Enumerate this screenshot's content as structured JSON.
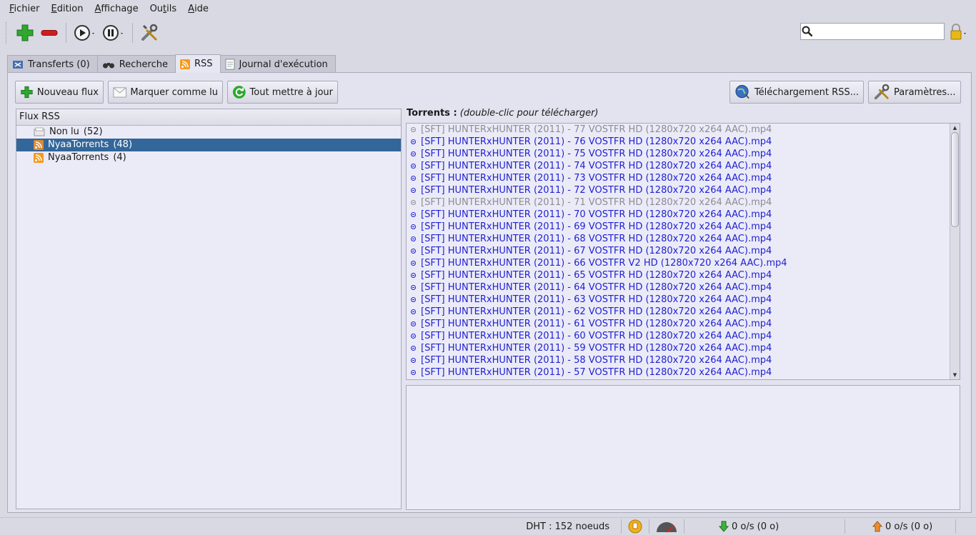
{
  "menu": [
    "Fichier",
    "Edition",
    "Affichage",
    "Outils",
    "Aide"
  ],
  "menu_mnemonics": [
    "F",
    "E",
    "A",
    "t",
    "A"
  ],
  "search": {
    "value": ""
  },
  "tabs": [
    {
      "label": "Transferts (0)",
      "icon": "transfer-icon"
    },
    {
      "label": "Recherche",
      "icon": "binoculars-icon"
    },
    {
      "label": "RSS",
      "icon": "rss-icon"
    },
    {
      "label": "Journal d'exécution",
      "icon": "log-icon"
    }
  ],
  "rss_buttons": {
    "new_feed": "Nouveau flux",
    "mark_read": "Marquer comme lu",
    "update_all": "Tout mettre à jour",
    "rss_download": "Téléchargement RSS...",
    "settings": "Paramètres..."
  },
  "feeds": {
    "header": "Flux RSS",
    "items": [
      {
        "name": "Non lu",
        "count": "(52)",
        "icon": "unread-icon"
      },
      {
        "name": "NyaaTorrents",
        "count": "(48)",
        "icon": "rss-feed-icon",
        "selected": true
      },
      {
        "name": "NyaaTorrents",
        "count": "(4)",
        "icon": "rss-feed-icon"
      }
    ]
  },
  "torrents": {
    "label": "Torrents :",
    "hint": "(double-clic pour télécharger)",
    "items": [
      {
        "title": "[SFT] HUNTERxHUNTER (2011) - 77 VOSTFR HD (1280x720 x264 AAC).mp4",
        "read": true
      },
      {
        "title": "[SFT] HUNTERxHUNTER (2011) - 76 VOSTFR HD (1280x720 x264 AAC).mp4",
        "read": false
      },
      {
        "title": "[SFT] HUNTERxHUNTER (2011) - 75 VOSTFR HD (1280x720 x264 AAC).mp4",
        "read": false
      },
      {
        "title": "[SFT] HUNTERxHUNTER (2011) - 74 VOSTFR HD (1280x720 x264 AAC).mp4",
        "read": false
      },
      {
        "title": "[SFT] HUNTERxHUNTER (2011) - 73 VOSTFR HD (1280x720 x264 AAC).mp4",
        "read": false
      },
      {
        "title": "[SFT] HUNTERxHUNTER (2011) - 72 VOSTFR HD (1280x720 x264 AAC).mp4",
        "read": false
      },
      {
        "title": "[SFT] HUNTERxHUNTER (2011) - 71 VOSTFR HD (1280x720 x264 AAC).mp4",
        "read": true
      },
      {
        "title": "[SFT] HUNTERxHUNTER (2011) - 70 VOSTFR HD (1280x720 x264 AAC).mp4",
        "read": false
      },
      {
        "title": "[SFT] HUNTERxHUNTER (2011) - 69 VOSTFR HD (1280x720 x264 AAC).mp4",
        "read": false
      },
      {
        "title": "[SFT] HUNTERxHUNTER (2011) - 68 VOSTFR HD (1280x720 x264 AAC).mp4",
        "read": false
      },
      {
        "title": "[SFT] HUNTERxHUNTER (2011) - 67 VOSTFR HD (1280x720 x264 AAC).mp4",
        "read": false
      },
      {
        "title": "[SFT] HUNTERxHUNTER (2011) - 66 VOSTFR V2 HD (1280x720 x264 AAC).mp4",
        "read": false
      },
      {
        "title": "[SFT] HUNTERxHUNTER (2011) - 65 VOSTFR HD (1280x720 x264 AAC).mp4",
        "read": false
      },
      {
        "title": "[SFT] HUNTERxHUNTER (2011) - 64 VOSTFR HD (1280x720 x264 AAC).mp4",
        "read": false
      },
      {
        "title": "[SFT] HUNTERxHUNTER (2011) - 63 VOSTFR HD (1280x720 x264 AAC).mp4",
        "read": false
      },
      {
        "title": "[SFT] HUNTERxHUNTER (2011) - 62 VOSTFR HD (1280x720 x264 AAC).mp4",
        "read": false
      },
      {
        "title": "[SFT] HUNTERxHUNTER (2011) - 61 VOSTFR HD (1280x720 x264 AAC).mp4",
        "read": false
      },
      {
        "title": "[SFT] HUNTERxHUNTER (2011) - 60 VOSTFR HD (1280x720 x264 AAC).mp4",
        "read": false
      },
      {
        "title": "[SFT] HUNTERxHUNTER (2011) - 59 VOSTFR HD (1280x720 x264 AAC).mp4",
        "read": false
      },
      {
        "title": "[SFT] HUNTERxHUNTER (2011) - 58 VOSTFR HD (1280x720 x264 AAC).mp4",
        "read": false
      },
      {
        "title": "[SFT] HUNTERxHUNTER (2011) - 57 VOSTFR HD (1280x720 x264 AAC).mp4",
        "read": false
      }
    ]
  },
  "status": {
    "dht": "DHT : 152 noeuds",
    "download": "0 o/s (0 o)",
    "upload": "0 o/s (0 o)"
  },
  "colors": {
    "unread_link": "#1f1fd2",
    "read_item": "#8c8c96",
    "selection": "#336699",
    "add_green": "#2ea82e",
    "remove_red": "#cc1e1e"
  }
}
